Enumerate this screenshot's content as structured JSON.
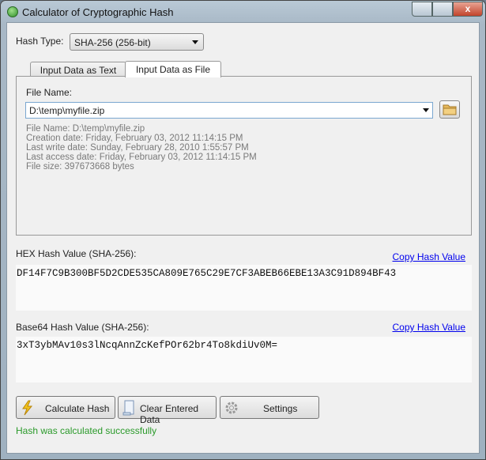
{
  "window": {
    "title": "Calculator of Cryptographic Hash",
    "close_glyph": "x"
  },
  "hash_type": {
    "label": "Hash Type:",
    "value": "SHA-256 (256-bit)"
  },
  "tabs": [
    {
      "label": "Input Data as Text",
      "selected": false
    },
    {
      "label": "Input Data as File",
      "selected": true
    }
  ],
  "file": {
    "label": "File Name:",
    "value": "D:\\temp\\myfile.zip",
    "info": [
      "File Name: D:\\temp\\myfile.zip",
      "Creation date: Friday, February 03, 2012 11:14:15 PM",
      "Last write date: Sunday, February 28, 2010 1:55:57 PM",
      "Last access date: Friday, February 03, 2012 11:14:15 PM",
      "File size: 397673668 bytes"
    ]
  },
  "hex": {
    "label": "HEX Hash Value (SHA-256):",
    "copy": "Copy Hash Value",
    "value": "DF14F7C9B300BF5D2CDE535CA809E765C29E7CF3ABEB66EBE13A3C91D894BF43"
  },
  "base64": {
    "label": "Base64 Hash Value (SHA-256):",
    "copy": "Copy Hash Value",
    "value": "3xT3ybMAv10s3lNcqAnnZcKefPOr62br4To8kdiUv0M="
  },
  "buttons": {
    "calculate": "Calculate Hash",
    "clear": "Clear Entered Data",
    "settings": "Settings"
  },
  "status": {
    "text": "Hash was calculated successfully",
    "color": "#2a9a2a"
  }
}
